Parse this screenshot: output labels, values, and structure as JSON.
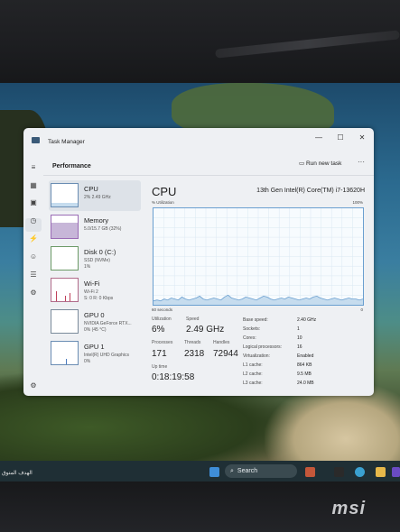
{
  "window": {
    "title": "Task Manager",
    "minimize": "—",
    "maximize": "☐",
    "close": "✕"
  },
  "header": {
    "section": "Performance",
    "run_task": "Run new task",
    "more": "···"
  },
  "devices": [
    {
      "name": "CPU",
      "line1": "2% 2.49 GHz",
      "line2": ""
    },
    {
      "name": "Memory",
      "line1": "5.0/15.7 GB (32%)",
      "line2": ""
    },
    {
      "name": "Disk 0 (C:)",
      "line1": "SSD (NVMe)",
      "line2": "1%"
    },
    {
      "name": "Wi-Fi",
      "line1": "Wi-Fi 2",
      "line2": "S: 0 R: 0 Kbps"
    },
    {
      "name": "GPU 0",
      "line1": "NVIDIA GeForce RTX...",
      "line2": "0% (45 °C)"
    },
    {
      "name": "GPU 1",
      "line1": "Intel(R) UHD Graphics",
      "line2": "0%"
    }
  ],
  "cpu": {
    "title": "CPU",
    "model": "13th Gen Intel(R) Core(TM) i7-13620H",
    "util_label": "% Utilization",
    "util_max": "100%",
    "time_label": "60 seconds",
    "zero": "0",
    "stats": {
      "utilization": {
        "label": "Utilization",
        "value": "6%"
      },
      "speed": {
        "label": "Speed",
        "value": "2.49 GHz"
      },
      "processes": {
        "label": "Processes",
        "value": "171"
      },
      "threads": {
        "label": "Threads",
        "value": "2318"
      },
      "handles": {
        "label": "Handles",
        "value": "72944"
      },
      "uptime": {
        "label": "Up time",
        "value": "0:18:19:58"
      }
    },
    "specs": [
      {
        "k": "Base speed:",
        "v": "2.40 GHz"
      },
      {
        "k": "Sockets:",
        "v": "1"
      },
      {
        "k": "Cores:",
        "v": "10"
      },
      {
        "k": "Logical processors:",
        "v": "16"
      },
      {
        "k": "Virtualization:",
        "v": "Enabled"
      },
      {
        "k": "L1 cache:",
        "v": "864 KB"
      },
      {
        "k": "L2 cache:",
        "v": "9.5 MB"
      },
      {
        "k": "L3 cache:",
        "v": "24.0 MB"
      }
    ],
    "graph_values": [
      4,
      5,
      4,
      6,
      5,
      7,
      6,
      5,
      8,
      6,
      5,
      6,
      7,
      9,
      6,
      5,
      6,
      7,
      6,
      5,
      8,
      10,
      7,
      6,
      5,
      6,
      8,
      7,
      6,
      5,
      7,
      9,
      8,
      6,
      5,
      6,
      7,
      6,
      8,
      7,
      6,
      5,
      6,
      7,
      6,
      8,
      9,
      7,
      6,
      5,
      6,
      7,
      6,
      5,
      6,
      7,
      6,
      6,
      5,
      6
    ]
  },
  "taskbar": {
    "search": "Search",
    "desktop_label": "الهدف المتوق"
  },
  "brand": {
    "logo": "msi"
  },
  "colors": {
    "accent": "#6a9fd0",
    "graph_fill": "#c6dcee"
  }
}
